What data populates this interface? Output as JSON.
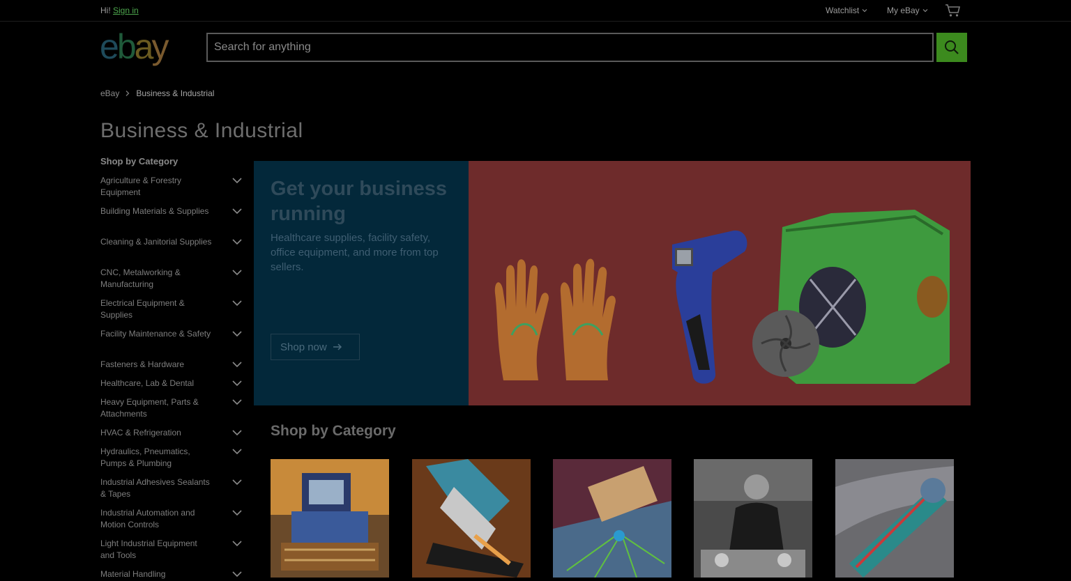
{
  "topbar": {
    "greeting": "Hi!",
    "signin": "Sign in",
    "watchlist": "Watchlist",
    "myebay": "My eBay"
  },
  "header": {
    "logo": [
      "e",
      "b",
      "a",
      "y"
    ],
    "search_placeholder": "Search for anything"
  },
  "breadcrumb": {
    "home": "eBay",
    "current": "Business & Industrial"
  },
  "page_title": "Business & Industrial",
  "sidebar": {
    "heading": "Shop by Category",
    "items": [
      {
        "label": "Agriculture & Forestry Equipment"
      },
      {
        "label": "Building Materials & Supplies"
      },
      {
        "label": "Cleaning & Janitorial Supplies"
      },
      {
        "label": "CNC, Metalworking & Manufacturing"
      },
      {
        "label": "Electrical Equipment & Supplies"
      },
      {
        "label": "Facility Maintenance & Safety"
      },
      {
        "label": "Fasteners & Hardware"
      },
      {
        "label": "Healthcare, Lab & Dental"
      },
      {
        "label": "Heavy Equipment, Parts & Attachments"
      },
      {
        "label": "HVAC & Refrigeration"
      },
      {
        "label": "Hydraulics, Pneumatics, Pumps & Plumbing"
      },
      {
        "label": "Industrial Adhesives Sealants & Tapes"
      },
      {
        "label": "Industrial Automation and Motion Controls"
      },
      {
        "label": "Light Industrial Equipment and Tools"
      },
      {
        "label": "Material Handling"
      }
    ]
  },
  "hero": {
    "title": "Get your business running",
    "subtitle": "Healthcare supplies, facility safety, office equipment, and more from top sellers.",
    "button": "Shop now",
    "colors": {
      "left": "#03283a",
      "right": "#6e2b2b"
    }
  },
  "shop_by_category": {
    "title": "Shop by Category",
    "tiles": [
      {
        "icon": "bulldozer-image"
      },
      {
        "icon": "microscope-image"
      },
      {
        "icon": "metal-cutting-image"
      },
      {
        "icon": "chef-kitchen-image"
      },
      {
        "icon": "pipe-wrench-image"
      }
    ]
  },
  "accent": "#3c8a1e"
}
